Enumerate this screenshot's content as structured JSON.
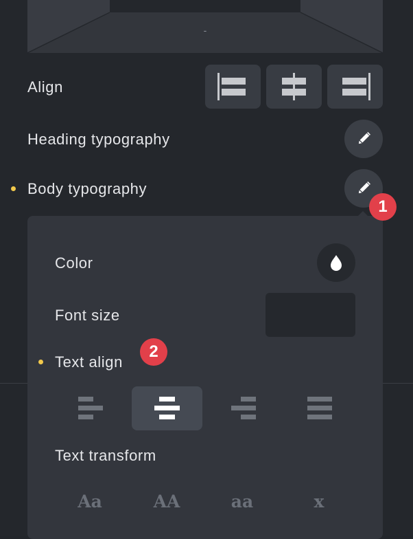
{
  "spacing": {
    "bottom_value": "-"
  },
  "align": {
    "label": "Align",
    "options": [
      {
        "name": "align-left"
      },
      {
        "name": "align-center"
      },
      {
        "name": "align-right"
      }
    ]
  },
  "heading_typography": {
    "label": "Heading typography",
    "edit_icon": "pencil-icon"
  },
  "body_typography": {
    "label": "Body typography",
    "edit_icon": "pencil-icon",
    "modified": true
  },
  "badges": {
    "first": "1",
    "second": "2"
  },
  "popup": {
    "color": {
      "label": "Color",
      "icon": "droplet-icon"
    },
    "font_size": {
      "label": "Font size",
      "value": ""
    },
    "text_align": {
      "label": "Text align",
      "modified": true,
      "selected": "center",
      "options": [
        "left",
        "center",
        "right",
        "justify"
      ]
    },
    "text_transform": {
      "label": "Text transform",
      "options": [
        "Aa",
        "AA",
        "aa",
        "x"
      ]
    }
  },
  "colors": {
    "background": "#24272c",
    "popup": "#33363d",
    "button": "#383c43",
    "accent_dot": "#f2c94c",
    "badge": "#e2404a"
  }
}
